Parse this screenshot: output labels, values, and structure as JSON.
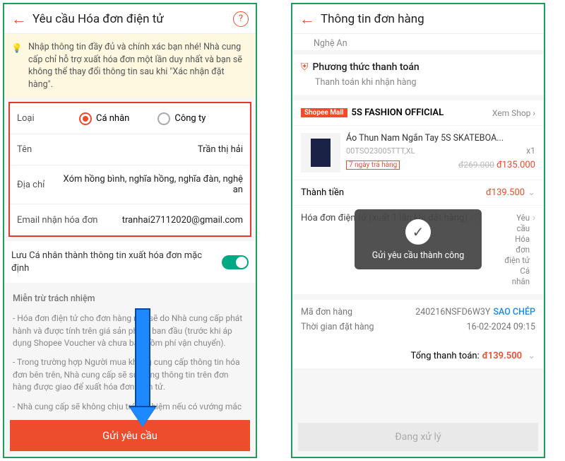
{
  "left": {
    "title": "Yêu cầu Hóa đơn điện tử",
    "notice": "Nhập thông tin đầy đủ và chính xác bạn nhé! Nhà cung cấp chỉ hỗ trợ xuất hóa đơn một lần duy nhất và bạn sẽ không thể thay đổi thông tin sau khi \"Xác nhận đặt hàng\".",
    "type_label": "Loại",
    "type_personal": "Cá nhân",
    "type_company": "Công ty",
    "name_label": "Tên",
    "name_value": "Trần thị hải",
    "addr_label": "Địa chỉ",
    "addr_value": "Xóm hồng bình, nghĩa hồng, nghĩa đàn, nghệ an",
    "email_label": "Email nhận hóa đơn",
    "email_value": "tranhai27112020@gmail.com",
    "save_default": "Lưu Cá nhân thành thông tin xuất hóa đơn mặc định",
    "disclaim_title": "Miễn trừ trách nhiệm",
    "disclaim_1": "- Hóa đơn điện tử cho đơn hàng này sẽ do Nhà cung cấp phát hành và được tính trên giá sản phẩm ban đầu (trước khi áp dụng Shopee Voucher và chưa bao gồm phí vận chuyển).",
    "disclaim_2": "- Trong trường hợp Người mua không cung cấp thông tin hóa đơn bên trên, Nhà cung cấp sẽ sử dụng thông tin trên đơn hàng được giao để xuất hóa đơn điện tử.",
    "disclaim_3": "- Nhà cung cấp sẽ không chịu trách nhiệm nếu có vướng mắc",
    "submit": "Gửi yêu cầu"
  },
  "right": {
    "title": "Thông tin đơn hàng",
    "address_tail": "Nghệ An",
    "payment_title": "Phương thức thanh toán",
    "payment_method": "Thanh toán khi nhận hàng",
    "mall": "Shopee Mall",
    "shop": "5S FASHION OFFICIAL",
    "view_shop": "Xem Shop",
    "product_name": "Áo Thun Nam Ngắn Tay 5S SKATEBOA...",
    "sku": "00TSO23005TTT,XL",
    "qty": "x1",
    "return7": "7 ngày trả hàng",
    "old_price": "đ269.000",
    "new_price": "đ135.000",
    "subtotal_label": "Thành tiền",
    "subtotal": "đ139.500",
    "einvoice_label": "Hóa đơn điện tử (xuất 1 lần khi đặt hàng)",
    "einvoice_val": "Yêu cầu Hóa đơn điện tử Cá nhân",
    "order_id_label": "Mã đơn hàng",
    "order_id": "240216NSFD6W3Y",
    "copy": "SAO CHÉP",
    "time_label": "Thời gian đặt hàng",
    "time_value": "16-02-2024 09:15",
    "grand_label": "Tổng thanh toán:",
    "grand_value": "đ139.500",
    "processing": "Đang xử lý",
    "toast": "Gửi yêu cầu thành công"
  }
}
